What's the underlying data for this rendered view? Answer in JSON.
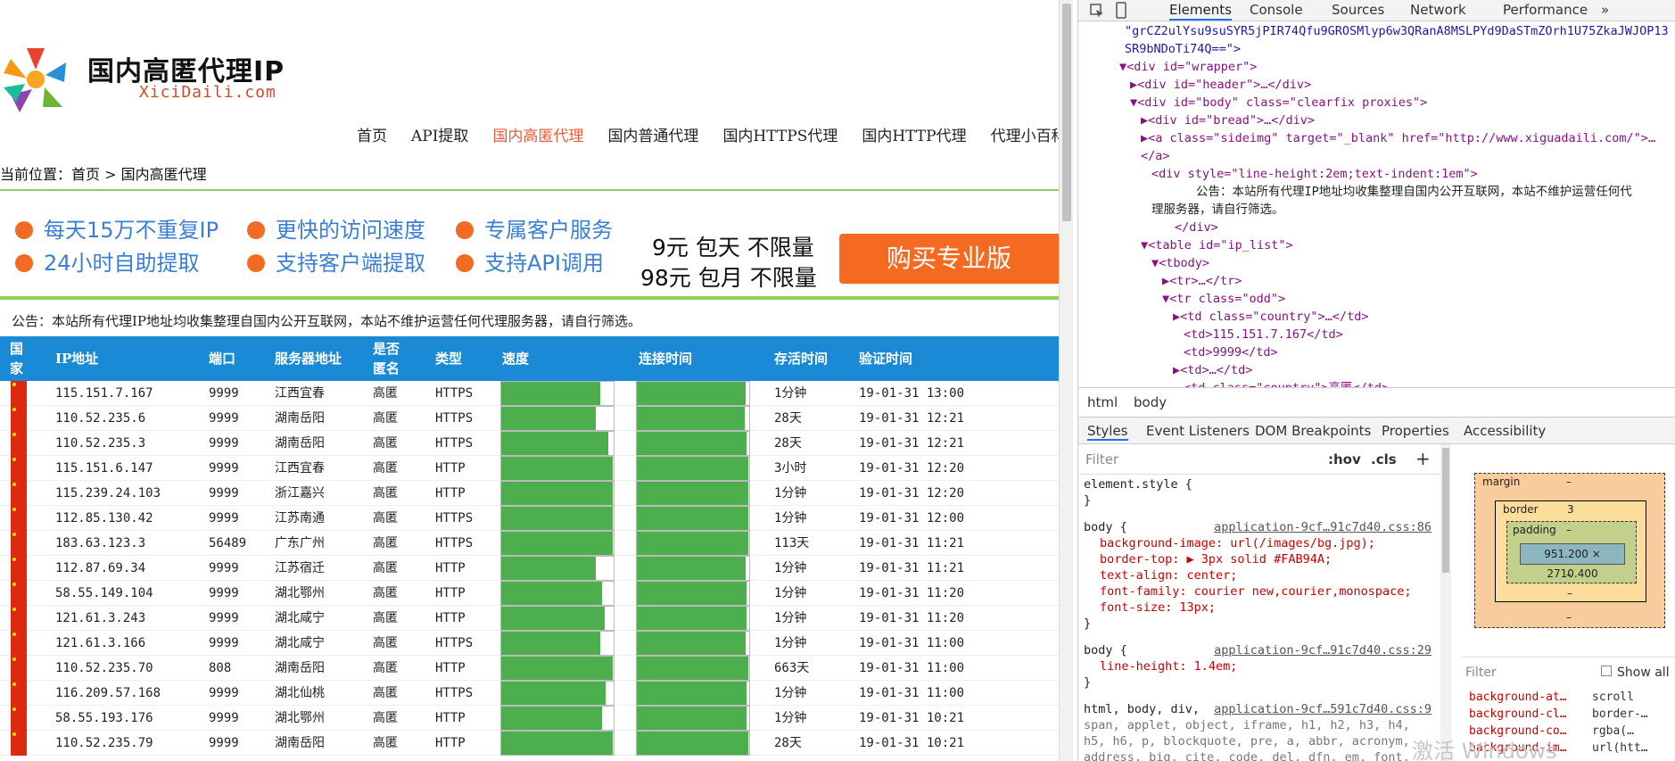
{
  "site": {
    "title": "国内高匿代理IP",
    "subtitle": "XiciDaili.com",
    "nav": [
      "首页",
      "API提取",
      "国内高匿代理",
      "国内普通代理",
      "国内HTTPS代理",
      "国内HTTP代理",
      "代理小百科"
    ],
    "breadcrumb": "当前位置：首页 > 国内高匿代理",
    "features": [
      "每天15万不重复IP",
      "更快的访问速度",
      "专属客户服务",
      "24小时自助提取",
      "支持客户端提取",
      "支持API调用"
    ],
    "price1": "9元 包天 不限量",
    "price2": "98元 包月 不限量",
    "buy_label": "购买专业版",
    "notice": "公告：本站所有代理IP地址均收集整理自国内公开互联网，本站不维护运营任何代理服务器，请自行筛选。",
    "headers": {
      "country": "国家",
      "ip": "IP地址",
      "port": "端口",
      "server": "服务器地址",
      "anon": "是否匿名",
      "type": "类型",
      "speed": "速度",
      "conn": "连接时间",
      "alive": "存活时间",
      "verify": "验证时间"
    },
    "rows": [
      {
        "ip": "115.151.7.167",
        "port": "9999",
        "loc": "江西宜春",
        "anon": "高匿",
        "type": "HTTPS",
        "speed": 0.88,
        "conn": 0.97,
        "alive": "1分钟",
        "time": "19-01-31 13:00"
      },
      {
        "ip": "110.52.235.6",
        "port": "9999",
        "loc": "湖南岳阳",
        "anon": "高匿",
        "type": "HTTPS",
        "speed": 0.84,
        "conn": 0.96,
        "alive": "28天",
        "time": "19-01-31 12:21"
      },
      {
        "ip": "110.52.235.3",
        "port": "9999",
        "loc": "湖南岳阳",
        "anon": "高匿",
        "type": "HTTPS",
        "speed": 0.95,
        "conn": 0.98,
        "alive": "28天",
        "time": "19-01-31 12:21"
      },
      {
        "ip": "115.151.6.147",
        "port": "9999",
        "loc": "江西宜春",
        "anon": "高匿",
        "type": "HTTP",
        "speed": 0.99,
        "conn": 0.99,
        "alive": "3小时",
        "time": "19-01-31 12:20"
      },
      {
        "ip": "115.239.24.103",
        "port": "9999",
        "loc": "浙江嘉兴",
        "anon": "高匿",
        "type": "HTTP",
        "speed": 0.99,
        "conn": 0.99,
        "alive": "1分钟",
        "time": "19-01-31 12:20"
      },
      {
        "ip": "112.85.130.42",
        "port": "9999",
        "loc": "江苏南通",
        "anon": "高匿",
        "type": "HTTPS",
        "speed": 0.99,
        "conn": 0.99,
        "alive": "1分钟",
        "time": "19-01-31 12:00"
      },
      {
        "ip": "183.63.123.3",
        "port": "56489",
        "loc": "广东广州",
        "anon": "高匿",
        "type": "HTTPS",
        "speed": 0.99,
        "conn": 0.99,
        "alive": "113天",
        "time": "19-01-31 11:21"
      },
      {
        "ip": "112.87.69.34",
        "port": "9999",
        "loc": "江苏宿迁",
        "anon": "高匿",
        "type": "HTTP",
        "speed": 0.84,
        "conn": 0.97,
        "alive": "1分钟",
        "time": "19-01-31 11:21"
      },
      {
        "ip": "58.55.149.104",
        "port": "9999",
        "loc": "湖北鄂州",
        "anon": "高匿",
        "type": "HTTP",
        "speed": 0.9,
        "conn": 0.98,
        "alive": "1分钟",
        "time": "19-01-31 11:20"
      },
      {
        "ip": "121.61.3.243",
        "port": "9999",
        "loc": "湖北咸宁",
        "anon": "高匿",
        "type": "HTTP",
        "speed": 0.92,
        "conn": 0.98,
        "alive": "1分钟",
        "time": "19-01-31 11:20"
      },
      {
        "ip": "121.61.3.166",
        "port": "9999",
        "loc": "湖北咸宁",
        "anon": "高匿",
        "type": "HTTPS",
        "speed": 0.88,
        "conn": 0.97,
        "alive": "1分钟",
        "time": "19-01-31 11:00"
      },
      {
        "ip": "110.52.235.70",
        "port": "808",
        "loc": "湖南岳阳",
        "anon": "高匿",
        "type": "HTTP",
        "speed": 0.99,
        "conn": 0.99,
        "alive": "663天",
        "time": "19-01-31 11:00"
      },
      {
        "ip": "116.209.57.168",
        "port": "9999",
        "loc": "湖北仙桃",
        "anon": "高匿",
        "type": "HTTPS",
        "speed": 0.93,
        "conn": 0.98,
        "alive": "1分钟",
        "time": "19-01-31 11:00"
      },
      {
        "ip": "58.55.193.176",
        "port": "9999",
        "loc": "湖北鄂州",
        "anon": "高匿",
        "type": "HTTP",
        "speed": 0.9,
        "conn": 0.98,
        "alive": "1分钟",
        "time": "19-01-31 10:21"
      },
      {
        "ip": "110.52.235.79",
        "port": "9999",
        "loc": "湖南岳阳",
        "anon": "高匿",
        "type": "HTTP",
        "speed": 0.99,
        "conn": 0.99,
        "alive": "28天",
        "time": "19-01-31 10:21"
      }
    ]
  },
  "devtools": {
    "tabs": [
      "Elements",
      "Console",
      "Sources",
      "Network",
      "Performance",
      "»"
    ],
    "dom": [
      {
        "t": "\"grCZ2ulYsu9suSYR5jPIR74Qfu9GROSMlyp6w3QRanA8MSLPYd9DaSTmZOrh1U75ZkaJWJOP13"
      },
      {
        "t": "SR9bNDoTi74Q==\">"
      },
      {
        "t": "▼<div id=\"wrapper\">"
      },
      {
        "t": "▶<div id=\"header\">…</div>"
      },
      {
        "t": "▼<div id=\"body\" class=\"clearfix proxies\">"
      },
      {
        "t": "▶<div id=\"bread\">…</div>"
      },
      {
        "t": "▶<a class=\"sideimg\" target=\"_blank\" href=\"http://www.xiguadaili.com/\">…"
      },
      {
        "t": "</a>"
      },
      {
        "t": "<div style=\"line-height:2em;text-indent:1em\">"
      },
      {
        "t": "公告：本站所有代理IP地址均收集整理自国内公开互联网，本站不维护运营任何代"
      },
      {
        "t": "理服务器，请自行筛选。"
      },
      {
        "t": "</div>"
      },
      {
        "t": "▼<table id=\"ip_list\">"
      },
      {
        "t": "▼<tbody>"
      },
      {
        "t": "▶<tr>…</tr>"
      },
      {
        "t": "▼<tr class=\"odd\">"
      },
      {
        "t": "▶<td class=\"country\">…</td>"
      },
      {
        "t": "<td>115.151.7.167</td>"
      },
      {
        "t": "<td>9999</td>"
      },
      {
        "t": "▶<td>…</td>"
      },
      {
        "t": "<td class=\"country\">高匿</td>"
      }
    ],
    "crumbs": [
      "html",
      "body"
    ],
    "subtabs": [
      "Styles",
      "Event Listeners",
      "DOM Breakpoints",
      "Properties",
      "Accessibility"
    ],
    "filter_placeholder": "Filter",
    "hov": ":hov",
    "cls": ".cls",
    "plus": "+",
    "styles": [
      {
        "t": "element.style {"
      },
      {
        "t": "}"
      },
      {
        "t": "body {",
        "src": "application-9cf…91c7d40.css:86"
      },
      {
        "t": "background-image: url(/images/bg.jpg);"
      },
      {
        "t": "border-top: ▶ 3px solid #FAB94A;"
      },
      {
        "t": "text-align: center;"
      },
      {
        "t": "font-family: courier new,courier,monospace;"
      },
      {
        "t": "font-size: 13px;"
      },
      {
        "t": "}"
      },
      {
        "t": "body {",
        "src": "application-9cf…91c7d40.css:29"
      },
      {
        "t": "line-height: 1.4em;"
      },
      {
        "t": "}"
      },
      {
        "t": "html, body, div,",
        "src": "application-9cf…591c7d40.css:9"
      },
      {
        "t": "span, applet, object, iframe, h1, h2, h3, h4,"
      },
      {
        "t": "h5, h6, p, blockquote, pre, a, abbr, acronym,"
      },
      {
        "t": "address, big, cite, code, del, dfn, em, font,"
      }
    ],
    "boxmodel": {
      "margin": "margin",
      "border": "border",
      "border_val": "3",
      "padding": "padding",
      "dash": "–",
      "content": "951.200 × 2710.400"
    },
    "computed_filter": "Filter",
    "show_all": "Show all",
    "computed": [
      {
        "k": "background-at…",
        "v": "scroll"
      },
      {
        "k": "background-cl…",
        "v": "border-…"
      },
      {
        "k": "background-co…",
        "v": "rgba(…"
      },
      {
        "k": "background-im…",
        "v": "url(htt…"
      }
    ]
  },
  "watermark": "激活 Windows"
}
